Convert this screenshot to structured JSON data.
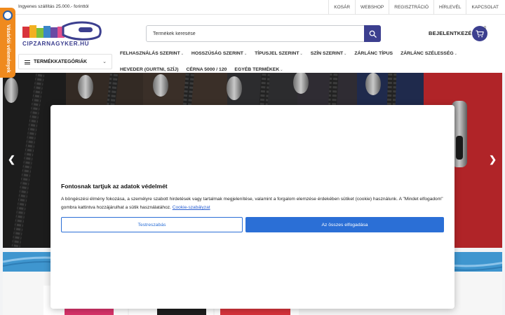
{
  "topbar": {
    "shipping_notice": "Ingyenes szállítás 25.000.- forinttól",
    "links": [
      "KOSÁR",
      "WEBSHOP",
      "REGISZTRÁCIÓ",
      "HÍRLEVÉL",
      "KAPCSOLAT"
    ]
  },
  "header": {
    "logo_text": "CIPZARNAGYKER.HU",
    "search": {
      "placeholder": "Termékek keresése",
      "value": ""
    },
    "login_label": "BEJELENTKEZÉS",
    "cart_count": "0",
    "categories_label": "TERMÉKKATEGÓRIÁK"
  },
  "nav": {
    "row1": [
      "FELHASZNÁLÁS SZERINT",
      "HOSSZÚSÁG SZERINT",
      "TÍPUSJEL SZERINT",
      "SZÍN SZERINT",
      "ZÁRLÁNC TÍPUS",
      "ZÁRLÁNC SZÉLESSÉG"
    ],
    "row2": [
      "HEVEDER (GURTNI, SZÍJ)",
      "CÉRNA 5000 / 120",
      "EGYÉB TERMÉKEK"
    ],
    "row1_has_dropdown": [
      true,
      true,
      true,
      true,
      false,
      true
    ],
    "row2_has_dropdown": [
      false,
      false,
      true
    ]
  },
  "sidetab": {
    "label": "Vásárlói vélemények"
  },
  "slider": {
    "prev_icon": "chevron-left-icon",
    "next_icon": "chevron-right-icon"
  },
  "consent": {
    "title": "Fontosnak tartjuk az adatok védelmét",
    "description": "A böngészési élmény fokozása, a személyre szabott hirdetések vagy tartalmak megjelenítése, valamint a forgalom elemzése érdekében sütiket (cookie) használunk. A \"Mindet elfogadom\" gombra kattintva hozzájárulhat a sütik használatához.",
    "policy_link": "Cookie-szabályzat",
    "customize_label": "Testreszabás",
    "accept_label": "Az összes elfogadása"
  },
  "colors": {
    "brand": "#3c3f8f",
    "accent_orange": "#ef8a1e",
    "button_blue": "#2b6fd6",
    "band_blue": "#3f96cf"
  }
}
